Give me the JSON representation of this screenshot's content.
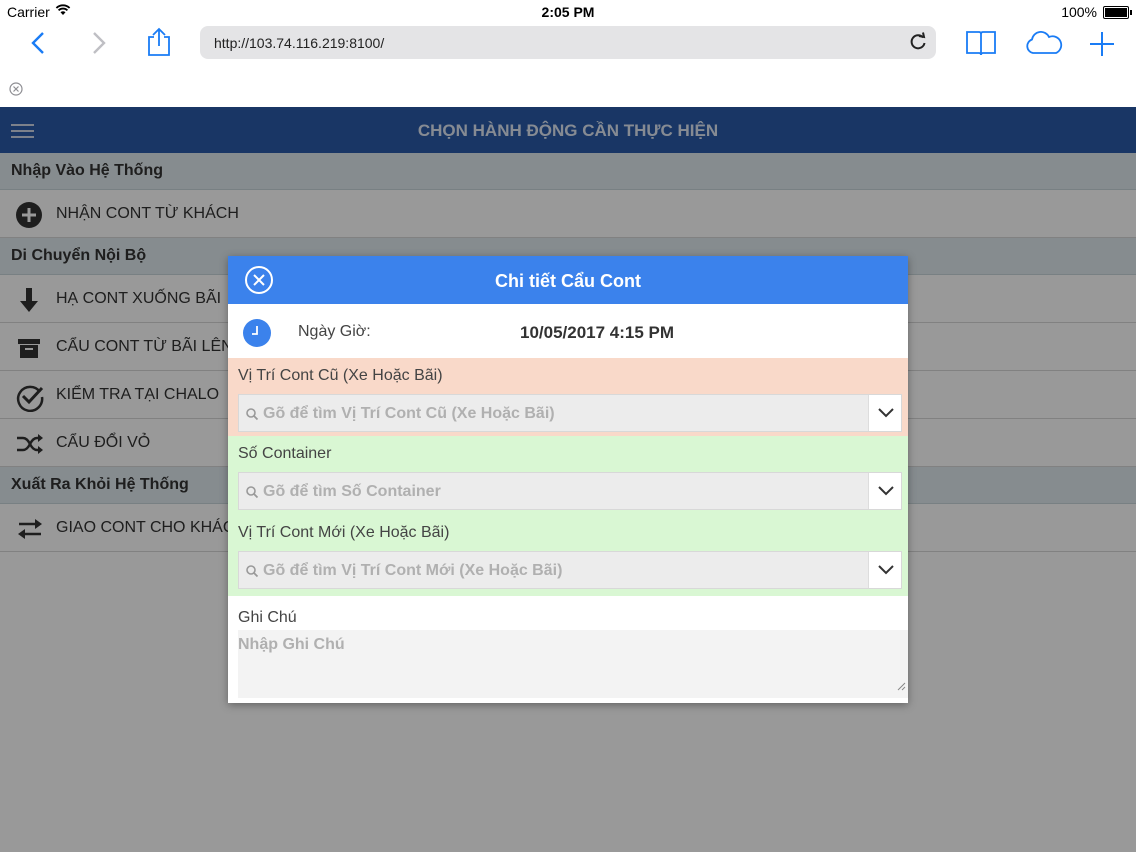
{
  "status": {
    "carrier": "Carrier",
    "time": "2:05 PM",
    "battery": "100%"
  },
  "browser": {
    "url": "http://103.74.116.219:8100/"
  },
  "app": {
    "title": "CHỌN HÀNH ĐỘNG CẦN THỰC HIỆN",
    "sections": [
      {
        "title": "Nhập Vào Hệ Thống",
        "items": [
          {
            "label": "NHẬN CONT TỪ KHÁCH",
            "icon": "plus-circle-icon"
          }
        ]
      },
      {
        "title": "Di Chuyển Nội Bộ",
        "items": [
          {
            "label": "HẠ CONT XUỐNG BÃI",
            "icon": "arrow-down-icon"
          },
          {
            "label": "CẨU CONT TỪ BÃI LÊN",
            "icon": "archive-box-icon"
          },
          {
            "label": "KIỂM TRA TẠI CHALO",
            "icon": "check-circle-icon"
          },
          {
            "label": "CẨU ĐỔI VỎ",
            "icon": "shuffle-icon"
          }
        ]
      },
      {
        "title": "Xuất Ra Khỏi Hệ Thống",
        "items": [
          {
            "label": "GIAO CONT CHO KHÁCH",
            "icon": "exchange-arrows-icon"
          }
        ]
      }
    ]
  },
  "modal": {
    "title": "Chi tiết Cẩu Cont",
    "datetime_label": "Ngày Giờ:",
    "datetime_value": "10/05/2017 4:15 PM",
    "fields": [
      {
        "label": "Vị Trí Cont Cũ (Xe Hoặc Bãi)",
        "placeholder": "Gõ để tìm Vị Trí Cont Cũ (Xe Hoặc Bãi)",
        "color": "#f9d9c9"
      },
      {
        "label": "Số Container",
        "placeholder": "Gõ để tìm Số Container",
        "color": "#d9f7d3"
      },
      {
        "label": "Vị Trí Cont Mới (Xe Hoặc Bãi)",
        "placeholder": "Gõ để tìm Vị Trí Cont Mới (Xe Hoặc Bãi)",
        "color": "#d9f7d3"
      }
    ],
    "notes_label": "Ghi Chú",
    "notes_placeholder": "Nhập Ghi Chú"
  },
  "colors": {
    "appbar": "#2b5ba8",
    "modal_header": "#3b82ec",
    "ios_blue": "#1a7cf5"
  }
}
